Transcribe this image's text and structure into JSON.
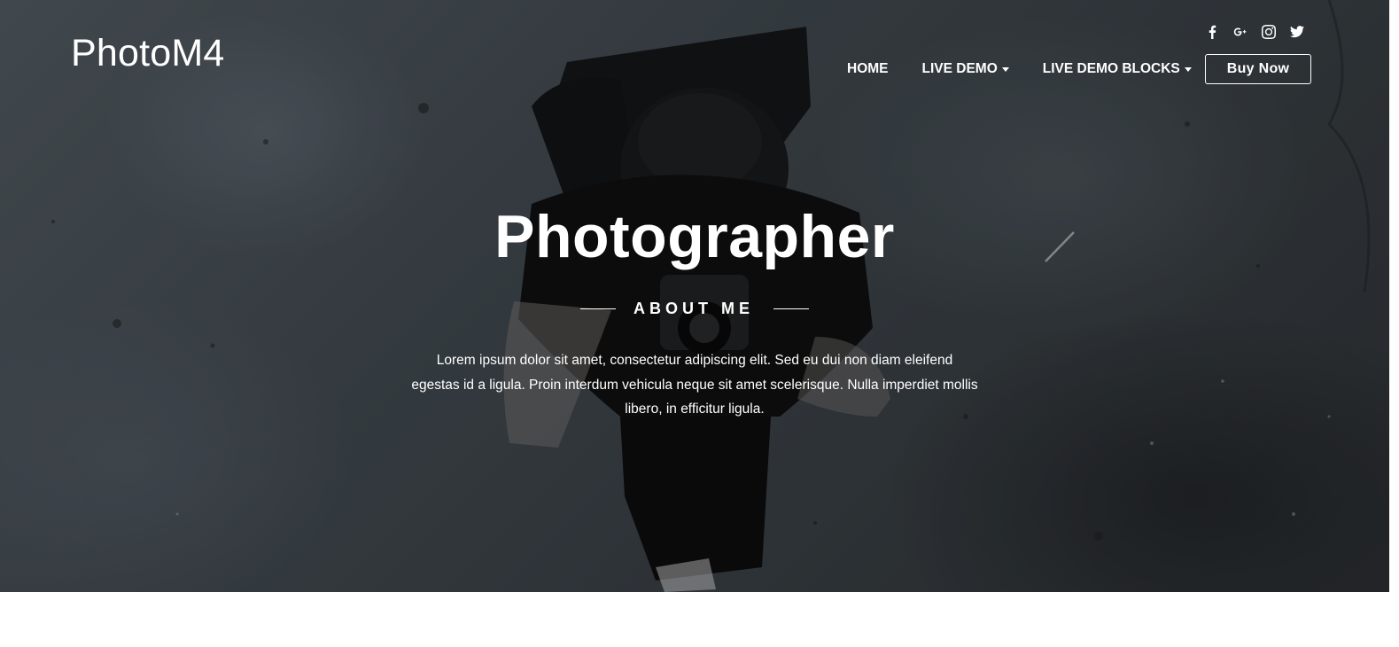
{
  "header": {
    "brand": "PhotoM4",
    "social": [
      "facebook-icon",
      "google-plus-icon",
      "instagram-icon",
      "twitter-icon"
    ],
    "nav": [
      {
        "label": "HOME",
        "dropdown": false
      },
      {
        "label": "LIVE DEMO",
        "dropdown": true
      },
      {
        "label": "LIVE DEMO BLOCKS",
        "dropdown": true
      }
    ],
    "cta": "Buy Now"
  },
  "hero": {
    "title": "Photographer",
    "subtitle": "ABOUT ME",
    "description": "Lorem ipsum dolor sit amet, consectetur adipiscing elit. Sed eu dui non diam eleifend egestas id a ligula. Proin interdum vehicula neque sit amet scelerisque. Nulla imperdiet mollis libero, in efficitur ligula."
  },
  "colors": {
    "text": "#ffffff",
    "hero_bg": "#3c4349",
    "page_bg": "#ffffff"
  }
}
